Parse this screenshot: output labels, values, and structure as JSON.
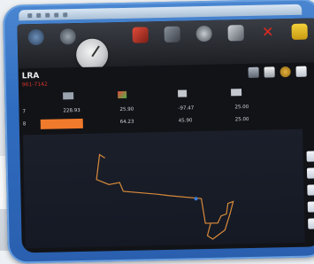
{
  "app": {
    "title": "LRA",
    "subtitle": "961-7142"
  },
  "toolbar": {
    "items": [
      {
        "icon": "globe-icon",
        "label": ""
      },
      {
        "icon": "satellite-icon",
        "label": ""
      },
      {
        "icon": "compass-gauge-icon",
        "label": ""
      },
      {
        "icon": "robot-arm-icon",
        "label": ""
      },
      {
        "icon": "path-icon",
        "label": ""
      },
      {
        "icon": "tool-icon",
        "label": ""
      },
      {
        "icon": "wrench-icon",
        "label": ""
      },
      {
        "icon": "cancel-x-icon",
        "label": ""
      },
      {
        "icon": "folder-icon",
        "label": ""
      }
    ]
  },
  "columns": [
    {
      "label": "",
      "icon": "axis-icon"
    },
    {
      "label": "",
      "icon": "arm-icon"
    },
    {
      "label": "",
      "icon": "rotation-icon"
    },
    {
      "label": "",
      "icon": "speed-icon"
    }
  ],
  "rows": [
    {
      "index": "7",
      "v1": "228.93",
      "v2": "25.90",
      "v3": "-97.47",
      "v4": "25.00",
      "selected": false
    },
    {
      "index": "8",
      "v1": "",
      "v2": "64.23",
      "v3": "45.90",
      "v4": "25.00",
      "selected": true
    }
  ],
  "colors": {
    "accent": "#f07a2c",
    "title_red": "#d0342c",
    "frame_blue": "#2f6cc0",
    "path_orange": "#d98a3a"
  }
}
